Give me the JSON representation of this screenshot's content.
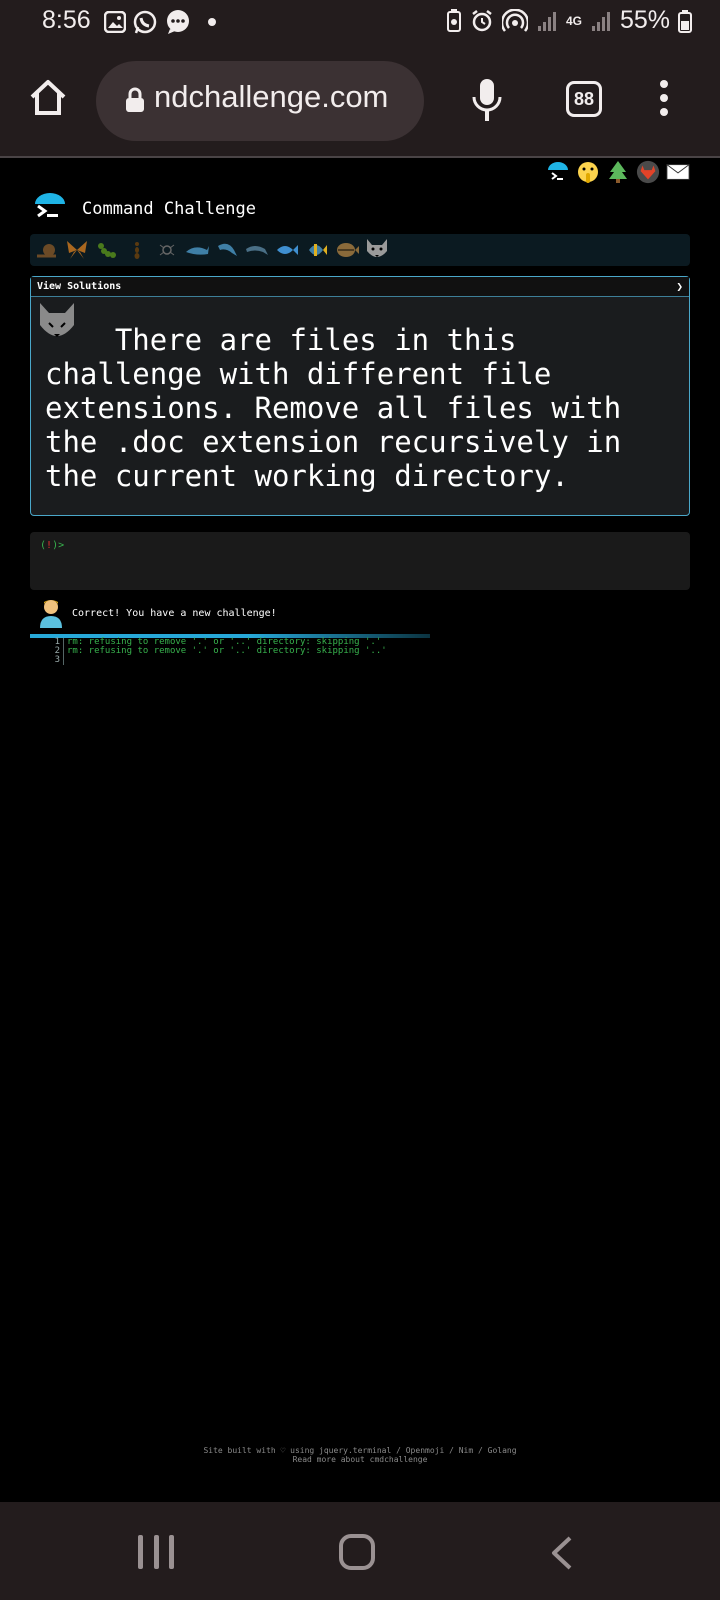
{
  "status_bar": {
    "time": "8:56",
    "battery": "55%",
    "network": "4G"
  },
  "browser": {
    "url": "ndchallenge.com",
    "tab_count": "88"
  },
  "page": {
    "site_title": "Command Challenge",
    "view_solutions_label": "View Solutions",
    "chevron": "❯",
    "challenge_text": "    There are files in this challenge with different file extensions. Remove all files with the .doc extension recursively in the current working directory.",
    "prompt": {
      "open": "(",
      "bang": "!",
      "close": ")>"
    },
    "feedback": "Correct! You have a new challenge!",
    "output_lines": [
      {
        "num": "1",
        "text": "rm: refusing to remove '.' or '..' directory: skipping '.'"
      },
      {
        "num": "2",
        "text": "rm: refusing to remove '.' or '..' directory: skipping '..'"
      },
      {
        "num": "3",
        "text": ""
      }
    ],
    "footer_line1": "Site built with ♡ using jquery.terminal / Openmoji / Nim / Golang",
    "footer_line2": "Read more about cmdchallenge"
  },
  "colors": {
    "accent": "#27a8d8",
    "prompt_green": "#37b24d",
    "prompt_red": "#e03131",
    "system_bar": "#231c1d"
  },
  "icons": {
    "top_links": [
      "terminal-umbrella-icon",
      "shushing-face-icon",
      "tree-icon",
      "gitlab-icon",
      "envelope-icon"
    ],
    "levels": [
      "snail-icon",
      "butterfly-icon",
      "caterpillar-icon",
      "ant-icon",
      "spider-icon",
      "shark-icon",
      "dolphin-icon",
      "dolphin-icon",
      "fish-icon",
      "tropical-fish-icon",
      "pufferfish-icon",
      "wolf-icon"
    ]
  }
}
